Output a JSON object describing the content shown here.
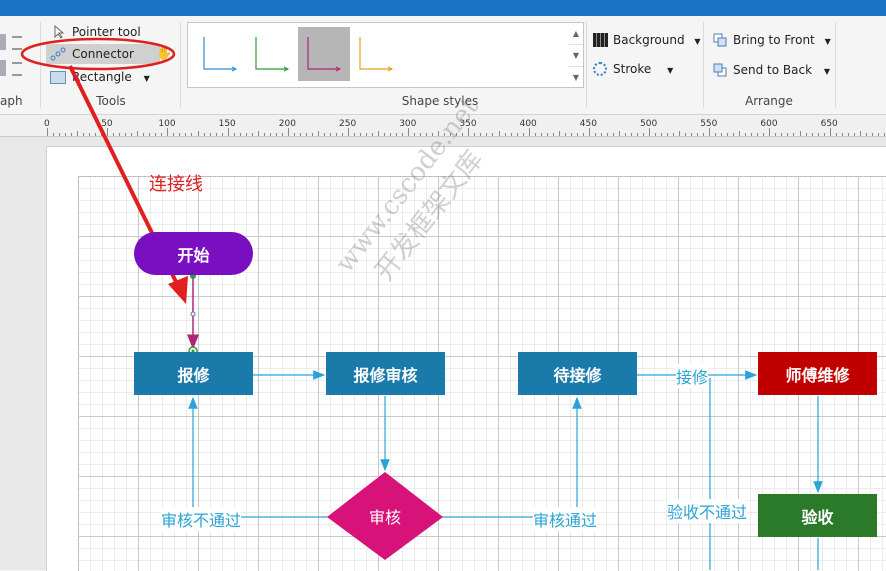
{
  "ribbon": {
    "partial_group": "aph",
    "tools": {
      "label": "Tools",
      "pointer": "Pointer tool",
      "connector": "Connector",
      "rectangle": "Rectangle"
    },
    "shape_styles": {
      "label": "Shape styles",
      "colors": [
        "#2a8fd0",
        "#2e9a3c",
        "#b0257a",
        "#e0a020"
      ]
    },
    "format": {
      "background": "Background",
      "stroke": "Stroke"
    },
    "arrange": {
      "label": "Arrange",
      "bring_front": "Bring to Front",
      "send_back": "Send to Back"
    }
  },
  "ruler": {
    "ticks": [
      "0",
      "50",
      "100",
      "150",
      "200",
      "250",
      "300",
      "350",
      "400",
      "450",
      "500",
      "550",
      "600",
      "650",
      "7"
    ]
  },
  "annotation": {
    "text": "连接线",
    "color": "#e02020"
  },
  "watermark": {
    "line1": "www.cscode.net",
    "line2": "开发框架文库"
  },
  "diagram": {
    "start": "开始",
    "report": "报修",
    "review_report": "报修审核",
    "review": "审核",
    "pending": "待接修",
    "master": "师傅维修",
    "accept": "验收",
    "edge_reject": "审核不通过",
    "edge_pass": "审核通过",
    "edge_take": "接修",
    "edge_fail": "验收不通过",
    "colors": {
      "purple": "#7a0fc2",
      "blue": "#1a7aaa",
      "magenta": "#d7137a",
      "red": "#c00000",
      "green": "#2a7a2a",
      "line": "#2aa3d6"
    }
  }
}
